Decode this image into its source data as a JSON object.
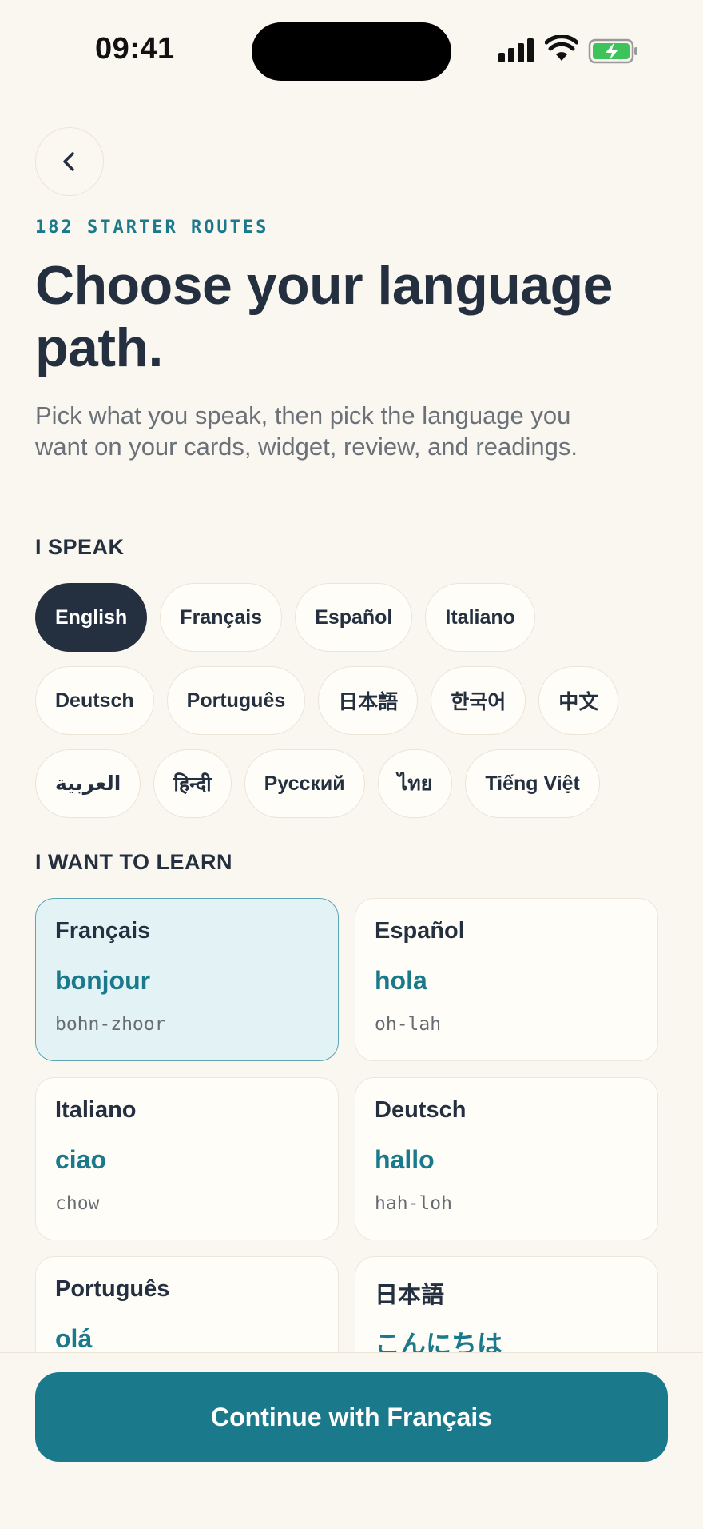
{
  "status_bar": {
    "time": "09:41",
    "icons": [
      "signal-icon",
      "wifi-icon",
      "battery-charging-icon"
    ],
    "battery_color": "#3cc35a"
  },
  "header": {
    "back_icon": "chevron-left-icon",
    "eyebrow": "182 STARTER ROUTES",
    "title": "Choose your language path.",
    "subtitle": "Pick what you speak, then pick the language you want on your cards, widget, review, and readings."
  },
  "speak": {
    "label": "I SPEAK",
    "selected": "English",
    "rows": [
      [
        "English",
        "Français",
        "Español",
        "Italiano"
      ],
      [
        "Deutsch",
        "Português",
        "日本語",
        "한국어",
        "中文"
      ],
      [
        "العربية",
        "हिन्दी",
        "Русский",
        "ไทย",
        "Tiếng Việt"
      ]
    ]
  },
  "learn": {
    "label": "I WANT TO LEARN",
    "selected": "Français",
    "cards": [
      {
        "name": "Français",
        "word": "bonjour",
        "pron": "bohn-zhoor"
      },
      {
        "name": "Español",
        "word": "hola",
        "pron": "oh-lah"
      },
      {
        "name": "Italiano",
        "word": "ciao",
        "pron": "chow"
      },
      {
        "name": "Deutsch",
        "word": "hallo",
        "pron": "hah-loh"
      },
      {
        "name": "Português",
        "word": "olá",
        "pron": ""
      },
      {
        "name": "日本語",
        "word": "こんにちは",
        "pron": ""
      }
    ]
  },
  "footer": {
    "cta_label": "Continue with Français"
  },
  "colors": {
    "background": "#faf6f0",
    "ink": "#24303f",
    "accent": "#1a7a8c",
    "selected_card_bg": "#e3f2f5"
  }
}
